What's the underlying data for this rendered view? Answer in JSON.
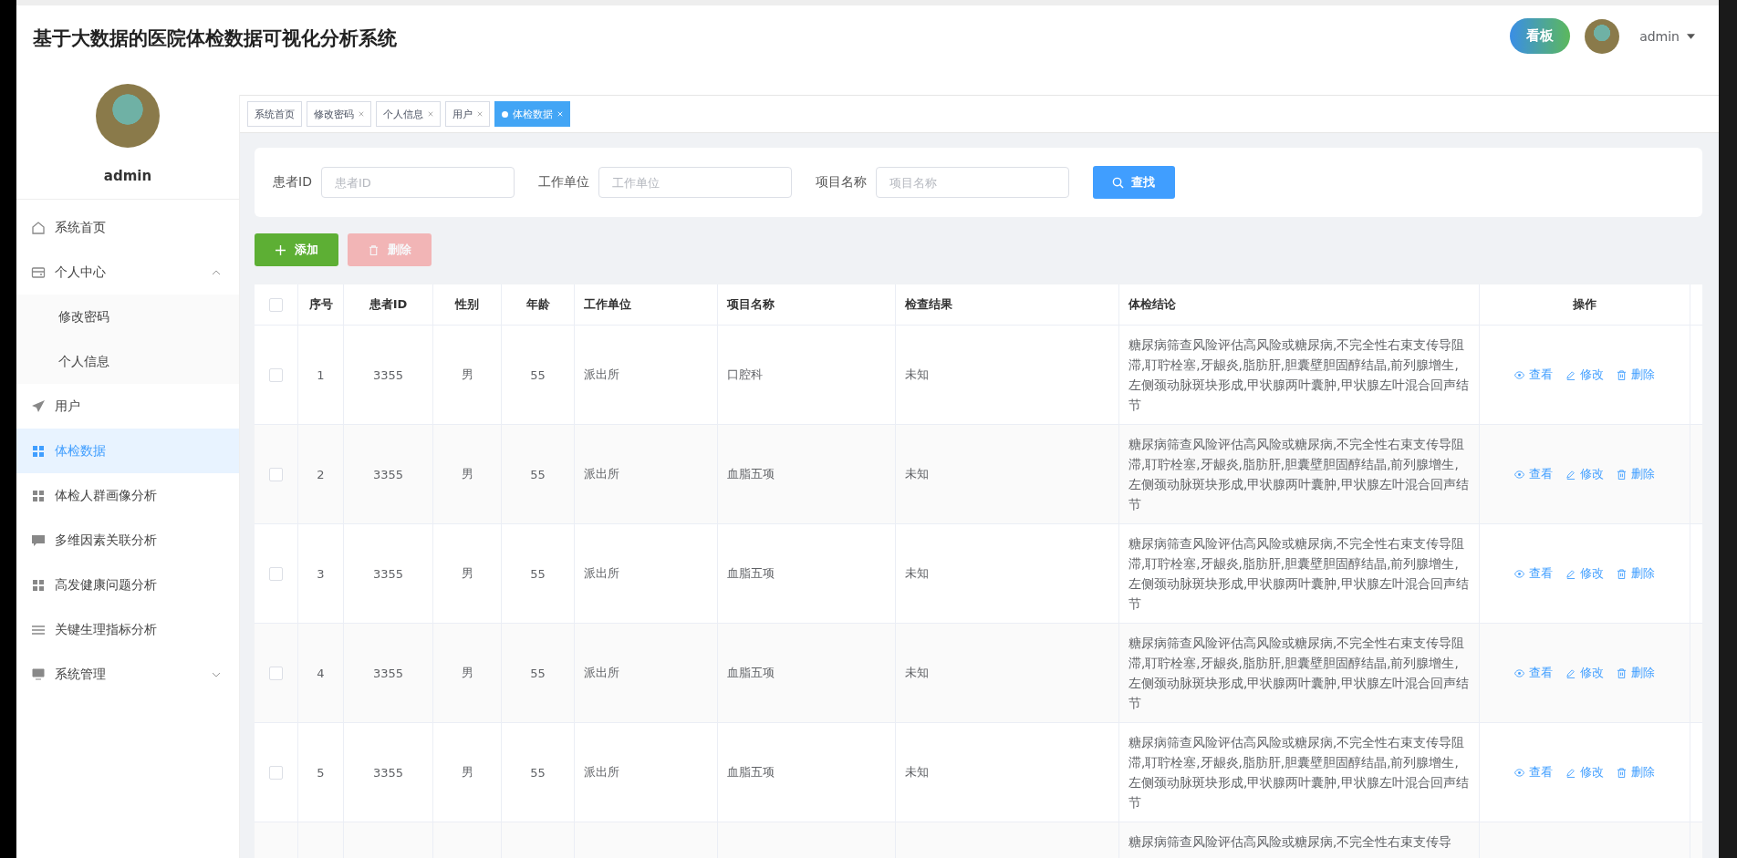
{
  "header": {
    "title": "基于大数据的医院体检数据可视化分析系统",
    "board_button": "看板",
    "user": "admin"
  },
  "sidebar": {
    "user": "admin",
    "items": [
      {
        "label": "系统首页",
        "kind": "home",
        "selected": false
      },
      {
        "label": "个人中心",
        "kind": "card",
        "selected": false,
        "expanded": true,
        "children": [
          {
            "label": "修改密码",
            "selected": false
          },
          {
            "label": "个人信息",
            "selected": false
          }
        ]
      },
      {
        "label": "用户",
        "kind": "plane",
        "selected": false
      },
      {
        "label": "体检数据",
        "kind": "grid",
        "selected": true
      },
      {
        "label": "体检人群画像分析",
        "kind": "grid",
        "selected": false
      },
      {
        "label": "多维因素关联分析",
        "kind": "chat",
        "selected": false
      },
      {
        "label": "高发健康问题分析",
        "kind": "grid",
        "selected": false
      },
      {
        "label": "关键生理指标分析",
        "kind": "list",
        "selected": false
      },
      {
        "label": "系统管理",
        "kind": "monitor",
        "selected": false,
        "expanded": false
      }
    ]
  },
  "tabs": [
    {
      "label": "系统首页",
      "closable": false,
      "selected": false
    },
    {
      "label": "修改密码",
      "closable": true,
      "selected": false
    },
    {
      "label": "个人信息",
      "closable": true,
      "selected": false
    },
    {
      "label": "用户",
      "closable": true,
      "selected": false
    },
    {
      "label": "体检数据",
      "closable": true,
      "selected": true
    }
  ],
  "search": {
    "fields": [
      {
        "label": "患者ID",
        "placeholder": "患者ID"
      },
      {
        "label": "工作单位",
        "placeholder": "工作单位"
      },
      {
        "label": "项目名称",
        "placeholder": "项目名称"
      }
    ],
    "button": "查找"
  },
  "actions": [
    {
      "label": "添加",
      "kind": "add",
      "disabled": false
    },
    {
      "label": "删除",
      "kind": "delete",
      "disabled": true
    }
  ],
  "table": {
    "all_checked": false,
    "columns": [
      "序号",
      "患者ID",
      "性别",
      "年龄",
      "工作单位",
      "项目名称",
      "检查结果",
      "体检结论",
      "操作"
    ],
    "rows": [
      {
        "checked": false,
        "no": "1",
        "patient_id": "3355",
        "sex": "男",
        "age": "55",
        "unit": "派出所",
        "item": "口腔科",
        "result": "未知",
        "conclusion": "糖尿病筛查风险评估高风险或糖尿病,不完全性右束支传导阻滞,耵聍栓塞,牙龈炎,脂肪肝,胆囊壁胆固醇结晶,前列腺增生,左侧颈动脉斑块形成,甲状腺两叶囊肿,甲状腺左叶混合回声结节",
        "ops": [
          "查看",
          "修改",
          "删除"
        ]
      },
      {
        "checked": false,
        "no": "2",
        "patient_id": "3355",
        "sex": "男",
        "age": "55",
        "unit": "派出所",
        "item": "血脂五项",
        "result": "未知",
        "conclusion": "糖尿病筛查风险评估高风险或糖尿病,不完全性右束支传导阻滞,耵聍栓塞,牙龈炎,脂肪肝,胆囊壁胆固醇结晶,前列腺增生,左侧颈动脉斑块形成,甲状腺两叶囊肿,甲状腺左叶混合回声结节",
        "ops": [
          "查看",
          "修改",
          "删除"
        ]
      },
      {
        "checked": false,
        "no": "3",
        "patient_id": "3355",
        "sex": "男",
        "age": "55",
        "unit": "派出所",
        "item": "血脂五项",
        "result": "未知",
        "conclusion": "糖尿病筛查风险评估高风险或糖尿病,不完全性右束支传导阻滞,耵聍栓塞,牙龈炎,脂肪肝,胆囊壁胆固醇结晶,前列腺增生,左侧颈动脉斑块形成,甲状腺两叶囊肿,甲状腺左叶混合回声结节",
        "ops": [
          "查看",
          "修改",
          "删除"
        ]
      },
      {
        "checked": false,
        "no": "4",
        "patient_id": "3355",
        "sex": "男",
        "age": "55",
        "unit": "派出所",
        "item": "血脂五项",
        "result": "未知",
        "conclusion": "糖尿病筛查风险评估高风险或糖尿病,不完全性右束支传导阻滞,耵聍栓塞,牙龈炎,脂肪肝,胆囊壁胆固醇结晶,前列腺增生,左侧颈动脉斑块形成,甲状腺两叶囊肿,甲状腺左叶混合回声结节",
        "ops": [
          "查看",
          "修改",
          "删除"
        ]
      },
      {
        "checked": false,
        "no": "5",
        "patient_id": "3355",
        "sex": "男",
        "age": "55",
        "unit": "派出所",
        "item": "血脂五项",
        "result": "未知",
        "conclusion": "糖尿病筛查风险评估高风险或糖尿病,不完全性右束支传导阻滞,耵聍栓塞,牙龈炎,脂肪肝,胆囊壁胆固醇结晶,前列腺增生,左侧颈动脉斑块形成,甲状腺两叶囊肿,甲状腺左叶混合回声结节",
        "ops": [
          "查看",
          "修改",
          "删除"
        ]
      },
      {
        "conclusion": "糖尿病筛查风险评估高风险或糖尿病,不完全性右束支传导"
      }
    ]
  }
}
